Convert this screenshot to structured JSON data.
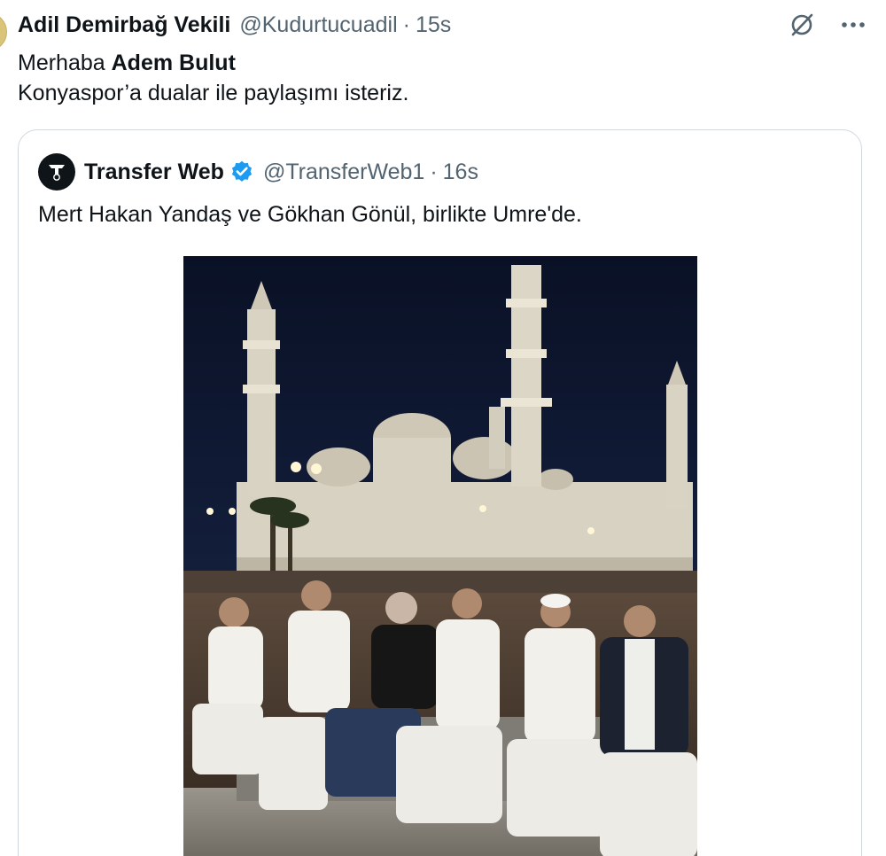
{
  "tweet": {
    "author_name": "Adil Demirbağ Vekili",
    "author_handle": "@Kudurtucuadil",
    "separator": "·",
    "time": "15s",
    "text_line1_prefix": "Merhaba ",
    "text_line1_bold": "Adem Bulut",
    "text_line2": "Konyaspor’a dualar ile paylaşımı isteriz.",
    "actions": {
      "grok_icon": "grok-icon",
      "more_icon": "more-icon"
    }
  },
  "quote": {
    "author_name": "Transfer Web",
    "verified_icon": "verified-badge-icon",
    "verified_color": "#1d9bf0",
    "author_handle": "@TransferWeb1",
    "separator": "·",
    "time": "16s",
    "text": "Mert Hakan Yandaş ve Gökhan Gönül, birlikte Umre'de.",
    "photo": {
      "subject": "mosque-at-night-with-six-men-seated"
    }
  },
  "colors": {
    "text_primary": "#0f1419",
    "text_secondary": "#536471",
    "border": "#cfd9de",
    "accent": "#1d9bf0"
  }
}
